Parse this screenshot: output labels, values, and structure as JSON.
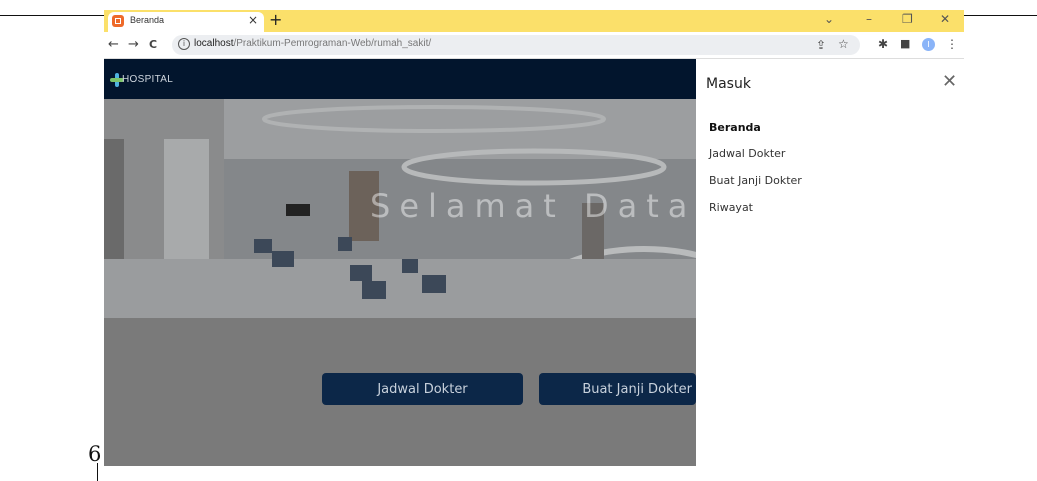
{
  "page": {
    "number": "6"
  },
  "browser": {
    "tab_title": "Beranda",
    "tab_close": "×",
    "new_tab": "+",
    "window_controls": {
      "dropdown": "⌄",
      "minimize": "–",
      "restore": "❐",
      "close": "✕"
    },
    "nav": {
      "back": "←",
      "forward": "→",
      "reload": "C"
    },
    "url_host": "localhost",
    "url_path": "/Praktikum-Pemrograman-Web/rumah_sakit/",
    "profile_initial": "I",
    "icons": [
      "share-icon",
      "star-icon",
      "extensions-icon",
      "sidepanel-icon",
      "menu-icon"
    ]
  },
  "site": {
    "logo_text": "HOSPITAL",
    "hero_title": "Selamat Datang!",
    "buttons": {
      "jadwal": "Jadwal Dokter",
      "buat_janji": "Buat Janji Dokter"
    },
    "offcanvas": {
      "title": "Masuk",
      "close": "✕",
      "items": [
        {
          "label": "Beranda",
          "active": true
        },
        {
          "label": "Jadwal Dokter"
        },
        {
          "label": "Buat Janji Dokter"
        },
        {
          "label": "Riwayat"
        }
      ]
    }
  },
  "colors": {
    "tabbar": "#fbe06a",
    "navbar": "#02152d",
    "button": "#0c2748",
    "logo": "#4fb3e0"
  }
}
